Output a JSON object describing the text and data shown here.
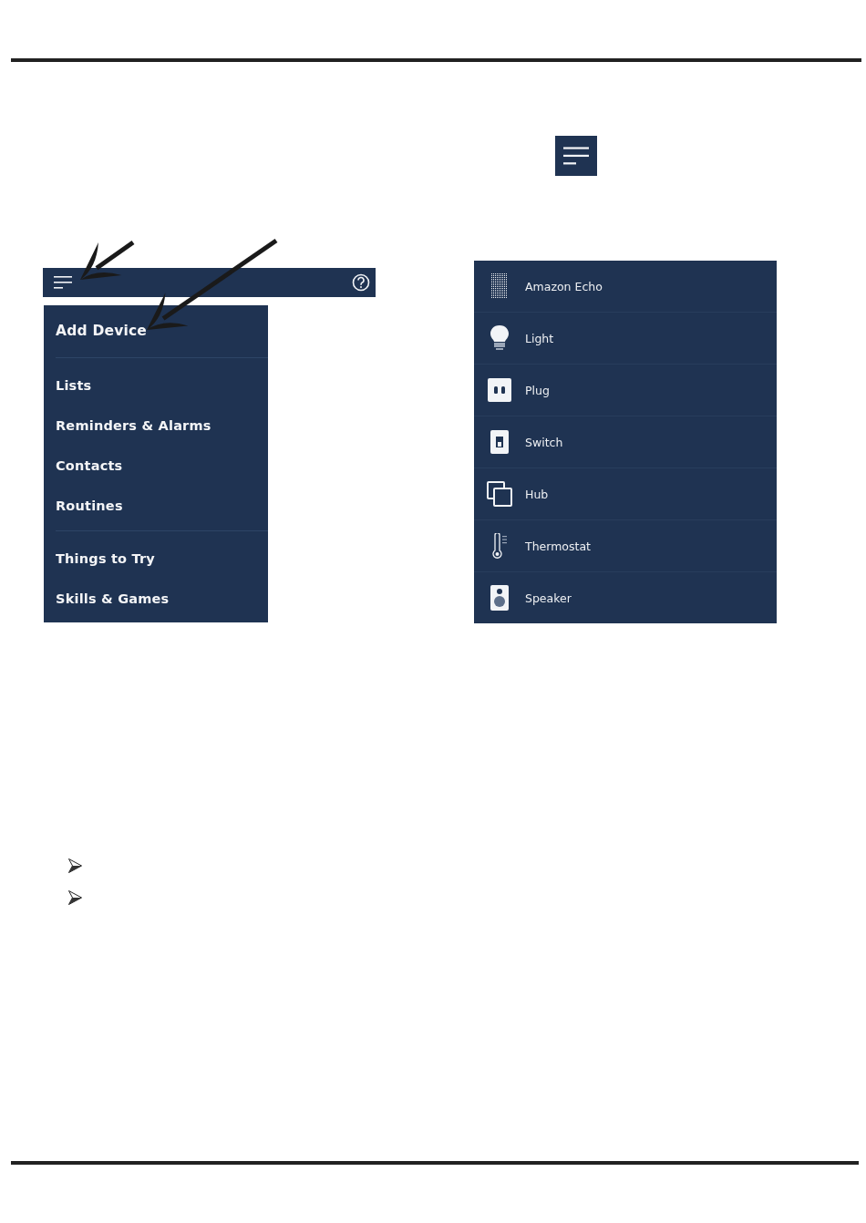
{
  "menu_button": {
    "kind": "hamburger"
  },
  "app_bar": {
    "buttons": [
      {
        "kind": "menu"
      },
      {
        "kind": "help"
      }
    ]
  },
  "menu": {
    "groups": [
      {
        "items": [
          {
            "label": "Add Device",
            "kind": "primary"
          }
        ]
      },
      {
        "items": [
          {
            "label": "Lists",
            "kind": "normal"
          },
          {
            "label": "Reminders & Alarms",
            "kind": "normal"
          },
          {
            "label": "Contacts",
            "kind": "normal"
          },
          {
            "label": "Routines",
            "kind": "normal"
          }
        ]
      },
      {
        "items": [
          {
            "label": "Things to Try",
            "kind": "normal"
          },
          {
            "label": "Skills & Games",
            "kind": "normal"
          }
        ]
      }
    ]
  },
  "device_types": [
    {
      "label": "Amazon Echo",
      "kind": "echo"
    },
    {
      "label": "Light",
      "kind": "light"
    },
    {
      "label": "Plug",
      "kind": "plug"
    },
    {
      "label": "Switch",
      "kind": "switch"
    },
    {
      "label": "Hub",
      "kind": "hub"
    },
    {
      "label": "Thermostat",
      "kind": "thermostat"
    },
    {
      "label": "Speaker",
      "kind": "speaker"
    }
  ],
  "bullets": [
    {
      "kind": "arrowhead"
    },
    {
      "kind": "arrowhead"
    }
  ]
}
